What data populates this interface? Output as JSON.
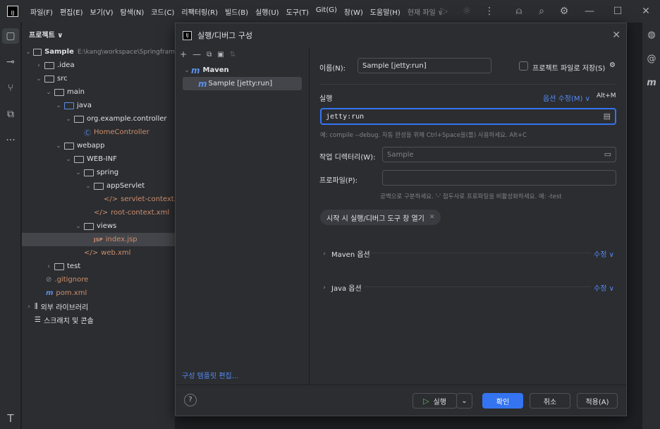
{
  "titlebar": {
    "logo": "IJ",
    "menu": [
      "파일(F)",
      "편집(E)",
      "보기(V)",
      "탐색(N)",
      "코드(C)",
      "리팩터링(R)",
      "빌드(B)",
      "실행(U)",
      "도구(T)",
      "Git(G)",
      "창(W)",
      "도움말(H)"
    ],
    "current_file": "현재 파일 ∨",
    "icons": [
      "run-icon",
      "debug-icon",
      "more-icon",
      "add-user-icon",
      "search-icon",
      "settings-icon",
      "minimize-icon",
      "maximize-icon",
      "close-icon"
    ]
  },
  "project": {
    "header": "프로젝트 ∨",
    "root_name": "Sample",
    "root_path": "E:\\kang\\workspace\\Springfram",
    "items": {
      "idea": ".idea",
      "src": "src",
      "main": "main",
      "java": "java",
      "package": "org.example.controller",
      "controller": "HomeController",
      "webapp": "webapp",
      "webinf": "WEB-INF",
      "spring": "spring",
      "appservlet": "appServlet",
      "servletctx": "servlet-context.xml",
      "rootctx": "root-context.xml",
      "views": "views",
      "indexjsp": "index.jsp",
      "webxml": "web.xml",
      "test": "test",
      "gitignore": ".gitignore",
      "pom": "pom.xml",
      "extlib": "외부 라이브러리",
      "scratch": "스크래치 및 콘솔"
    }
  },
  "dialog": {
    "title": "실행/디버그 구성",
    "tree_group": "Maven",
    "tree_item": "Sample [jetty:run]",
    "template_link": "구성 템플릿 편집...",
    "name_label": "이름(N):",
    "name_value": "Sample [jetty:run]",
    "store_label": "프로젝트 파일로 저장(S)",
    "run_section": "실행",
    "modify_options": "옵션 수정(M) ∨",
    "modify_shortcut": "Alt+M",
    "run_value": "jetty:run",
    "run_hint": "예: compile --debug. 자동 완성을 위해 Ctrl+Space을(를) 사용하세요. Alt+C",
    "workdir_label": "작업 디렉터리(W):",
    "workdir_placeholder": "Sample",
    "profiles_label": "프로파일(P):",
    "profiles_hint": "공백으로 구분하세요. '-' 접두사로 프로파일을 비활성화하세요. 예: -test",
    "chip_label": "시작 시 실행/디버그 도구 창 열기",
    "maven_options": "Maven 옵션",
    "java_options": "Java 옵션",
    "edit_link": "수정 ∨",
    "buttons": {
      "run": "실행",
      "ok": "확인",
      "cancel": "취소",
      "apply": "적용(A)"
    }
  }
}
